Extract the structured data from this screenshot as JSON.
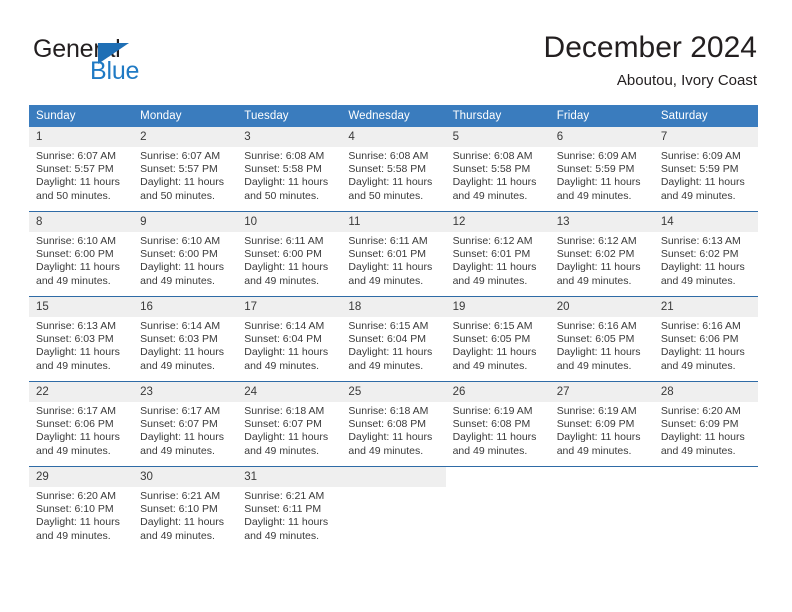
{
  "brand": {
    "name_part1": "General",
    "name_part2": "Blue",
    "triangle_color": "#1f6fb5",
    "blue_color": "#1f7ac4"
  },
  "header": {
    "month_title": "December 2024",
    "location": "Aboutou, Ivory Coast"
  },
  "calendar": {
    "header_bg": "#3a7cbe",
    "daynum_bg": "#efefef",
    "row_divider": "#2f6ba6",
    "weekdays": [
      "Sunday",
      "Monday",
      "Tuesday",
      "Wednesday",
      "Thursday",
      "Friday",
      "Saturday"
    ],
    "labels": {
      "sunrise": "Sunrise:",
      "sunset": "Sunset:",
      "daylight": "Daylight:"
    },
    "weeks": [
      [
        {
          "day": "1",
          "sunrise": "Sunrise: 6:07 AM",
          "sunset": "Sunset: 5:57 PM",
          "daylight1": "Daylight: 11 hours",
          "daylight2": "and 50 minutes."
        },
        {
          "day": "2",
          "sunrise": "Sunrise: 6:07 AM",
          "sunset": "Sunset: 5:57 PM",
          "daylight1": "Daylight: 11 hours",
          "daylight2": "and 50 minutes."
        },
        {
          "day": "3",
          "sunrise": "Sunrise: 6:08 AM",
          "sunset": "Sunset: 5:58 PM",
          "daylight1": "Daylight: 11 hours",
          "daylight2": "and 50 minutes."
        },
        {
          "day": "4",
          "sunrise": "Sunrise: 6:08 AM",
          "sunset": "Sunset: 5:58 PM",
          "daylight1": "Daylight: 11 hours",
          "daylight2": "and 50 minutes."
        },
        {
          "day": "5",
          "sunrise": "Sunrise: 6:08 AM",
          "sunset": "Sunset: 5:58 PM",
          "daylight1": "Daylight: 11 hours",
          "daylight2": "and 49 minutes."
        },
        {
          "day": "6",
          "sunrise": "Sunrise: 6:09 AM",
          "sunset": "Sunset: 5:59 PM",
          "daylight1": "Daylight: 11 hours",
          "daylight2": "and 49 minutes."
        },
        {
          "day": "7",
          "sunrise": "Sunrise: 6:09 AM",
          "sunset": "Sunset: 5:59 PM",
          "daylight1": "Daylight: 11 hours",
          "daylight2": "and 49 minutes."
        }
      ],
      [
        {
          "day": "8",
          "sunrise": "Sunrise: 6:10 AM",
          "sunset": "Sunset: 6:00 PM",
          "daylight1": "Daylight: 11 hours",
          "daylight2": "and 49 minutes."
        },
        {
          "day": "9",
          "sunrise": "Sunrise: 6:10 AM",
          "sunset": "Sunset: 6:00 PM",
          "daylight1": "Daylight: 11 hours",
          "daylight2": "and 49 minutes."
        },
        {
          "day": "10",
          "sunrise": "Sunrise: 6:11 AM",
          "sunset": "Sunset: 6:00 PM",
          "daylight1": "Daylight: 11 hours",
          "daylight2": "and 49 minutes."
        },
        {
          "day": "11",
          "sunrise": "Sunrise: 6:11 AM",
          "sunset": "Sunset: 6:01 PM",
          "daylight1": "Daylight: 11 hours",
          "daylight2": "and 49 minutes."
        },
        {
          "day": "12",
          "sunrise": "Sunrise: 6:12 AM",
          "sunset": "Sunset: 6:01 PM",
          "daylight1": "Daylight: 11 hours",
          "daylight2": "and 49 minutes."
        },
        {
          "day": "13",
          "sunrise": "Sunrise: 6:12 AM",
          "sunset": "Sunset: 6:02 PM",
          "daylight1": "Daylight: 11 hours",
          "daylight2": "and 49 minutes."
        },
        {
          "day": "14",
          "sunrise": "Sunrise: 6:13 AM",
          "sunset": "Sunset: 6:02 PM",
          "daylight1": "Daylight: 11 hours",
          "daylight2": "and 49 minutes."
        }
      ],
      [
        {
          "day": "15",
          "sunrise": "Sunrise: 6:13 AM",
          "sunset": "Sunset: 6:03 PM",
          "daylight1": "Daylight: 11 hours",
          "daylight2": "and 49 minutes."
        },
        {
          "day": "16",
          "sunrise": "Sunrise: 6:14 AM",
          "sunset": "Sunset: 6:03 PM",
          "daylight1": "Daylight: 11 hours",
          "daylight2": "and 49 minutes."
        },
        {
          "day": "17",
          "sunrise": "Sunrise: 6:14 AM",
          "sunset": "Sunset: 6:04 PM",
          "daylight1": "Daylight: 11 hours",
          "daylight2": "and 49 minutes."
        },
        {
          "day": "18",
          "sunrise": "Sunrise: 6:15 AM",
          "sunset": "Sunset: 6:04 PM",
          "daylight1": "Daylight: 11 hours",
          "daylight2": "and 49 minutes."
        },
        {
          "day": "19",
          "sunrise": "Sunrise: 6:15 AM",
          "sunset": "Sunset: 6:05 PM",
          "daylight1": "Daylight: 11 hours",
          "daylight2": "and 49 minutes."
        },
        {
          "day": "20",
          "sunrise": "Sunrise: 6:16 AM",
          "sunset": "Sunset: 6:05 PM",
          "daylight1": "Daylight: 11 hours",
          "daylight2": "and 49 minutes."
        },
        {
          "day": "21",
          "sunrise": "Sunrise: 6:16 AM",
          "sunset": "Sunset: 6:06 PM",
          "daylight1": "Daylight: 11 hours",
          "daylight2": "and 49 minutes."
        }
      ],
      [
        {
          "day": "22",
          "sunrise": "Sunrise: 6:17 AM",
          "sunset": "Sunset: 6:06 PM",
          "daylight1": "Daylight: 11 hours",
          "daylight2": "and 49 minutes."
        },
        {
          "day": "23",
          "sunrise": "Sunrise: 6:17 AM",
          "sunset": "Sunset: 6:07 PM",
          "daylight1": "Daylight: 11 hours",
          "daylight2": "and 49 minutes."
        },
        {
          "day": "24",
          "sunrise": "Sunrise: 6:18 AM",
          "sunset": "Sunset: 6:07 PM",
          "daylight1": "Daylight: 11 hours",
          "daylight2": "and 49 minutes."
        },
        {
          "day": "25",
          "sunrise": "Sunrise: 6:18 AM",
          "sunset": "Sunset: 6:08 PM",
          "daylight1": "Daylight: 11 hours",
          "daylight2": "and 49 minutes."
        },
        {
          "day": "26",
          "sunrise": "Sunrise: 6:19 AM",
          "sunset": "Sunset: 6:08 PM",
          "daylight1": "Daylight: 11 hours",
          "daylight2": "and 49 minutes."
        },
        {
          "day": "27",
          "sunrise": "Sunrise: 6:19 AM",
          "sunset": "Sunset: 6:09 PM",
          "daylight1": "Daylight: 11 hours",
          "daylight2": "and 49 minutes."
        },
        {
          "day": "28",
          "sunrise": "Sunrise: 6:20 AM",
          "sunset": "Sunset: 6:09 PM",
          "daylight1": "Daylight: 11 hours",
          "daylight2": "and 49 minutes."
        }
      ],
      [
        {
          "day": "29",
          "sunrise": "Sunrise: 6:20 AM",
          "sunset": "Sunset: 6:10 PM",
          "daylight1": "Daylight: 11 hours",
          "daylight2": "and 49 minutes."
        },
        {
          "day": "30",
          "sunrise": "Sunrise: 6:21 AM",
          "sunset": "Sunset: 6:10 PM",
          "daylight1": "Daylight: 11 hours",
          "daylight2": "and 49 minutes."
        },
        {
          "day": "31",
          "sunrise": "Sunrise: 6:21 AM",
          "sunset": "Sunset: 6:11 PM",
          "daylight1": "Daylight: 11 hours",
          "daylight2": "and 49 minutes."
        },
        {
          "day": "",
          "sunrise": "",
          "sunset": "",
          "daylight1": "",
          "daylight2": "",
          "empty": true
        },
        {
          "day": "",
          "sunrise": "",
          "sunset": "",
          "daylight1": "",
          "daylight2": "",
          "blank": true
        },
        {
          "day": "",
          "sunrise": "",
          "sunset": "",
          "daylight1": "",
          "daylight2": "",
          "blank": true
        },
        {
          "day": "",
          "sunrise": "",
          "sunset": "",
          "daylight1": "",
          "daylight2": "",
          "blank": true
        }
      ]
    ]
  }
}
